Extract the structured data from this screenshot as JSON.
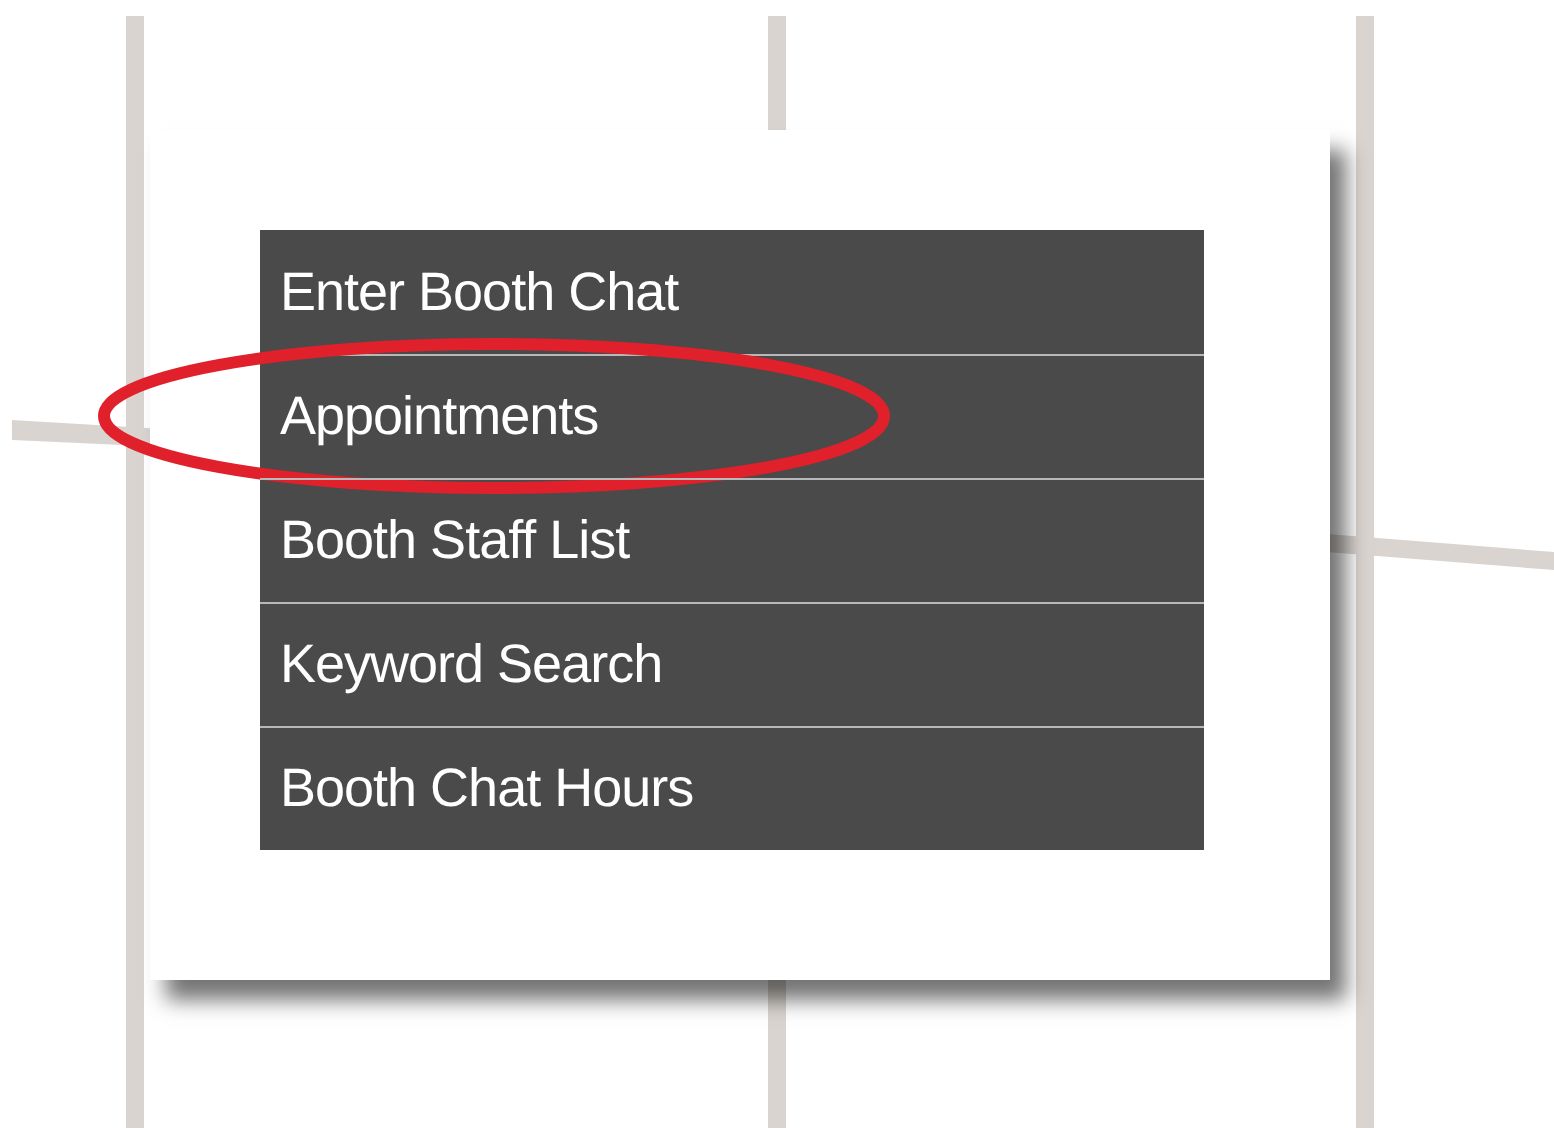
{
  "menu": {
    "items": [
      {
        "label": "Enter Booth Chat",
        "circled": false
      },
      {
        "label": "Appointments",
        "circled": true
      },
      {
        "label": "Booth Staff List",
        "circled": false
      },
      {
        "label": "Keyword Search",
        "circled": false
      },
      {
        "label": "Booth Chat Hours",
        "circled": false
      }
    ]
  }
}
